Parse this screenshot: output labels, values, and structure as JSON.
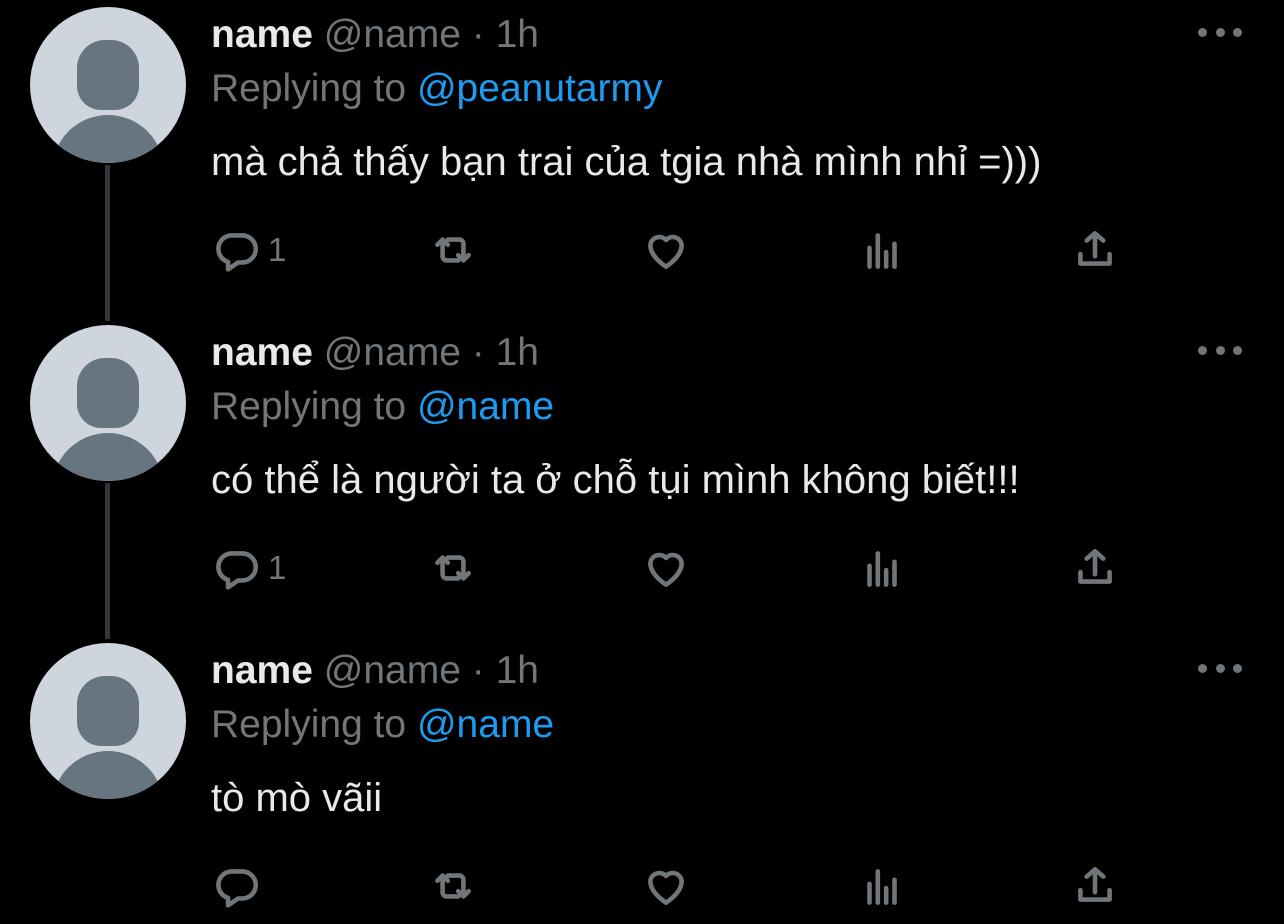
{
  "tweets": [
    {
      "name": "name",
      "handle": "@name",
      "separator": "·",
      "time": "1h",
      "replying_prefix": "Replying to",
      "replying_to": "@peanutarmy",
      "text": "mà chả thấy bạn trai của tgia nhà mình nhỉ =)))",
      "reply_count": "1"
    },
    {
      "name": "name",
      "handle": "@name",
      "separator": "·",
      "time": "1h",
      "replying_prefix": "Replying to",
      "replying_to": "@name",
      "text": "có thể là người ta ở chỗ tụi mình không biết!!!",
      "reply_count": "1"
    },
    {
      "name": "name",
      "handle": "@name",
      "separator": "·",
      "time": "1h",
      "replying_prefix": "Replying to",
      "replying_to": "@name",
      "text": "tò mò vãii",
      "reply_count": ""
    }
  ],
  "icons": {
    "reply": "reply-icon",
    "retweet": "retweet-icon",
    "like": "heart-icon",
    "views": "analytics-icon",
    "share": "share-icon",
    "more": "more-dots-icon"
  },
  "colors": {
    "background": "#000000",
    "text_primary": "#e7e9ea",
    "text_secondary": "#71767b",
    "accent": "#1d9bf0",
    "thread_line": "#333639",
    "avatar_bg": "#ced5dc",
    "avatar_fg": "#66757f"
  }
}
